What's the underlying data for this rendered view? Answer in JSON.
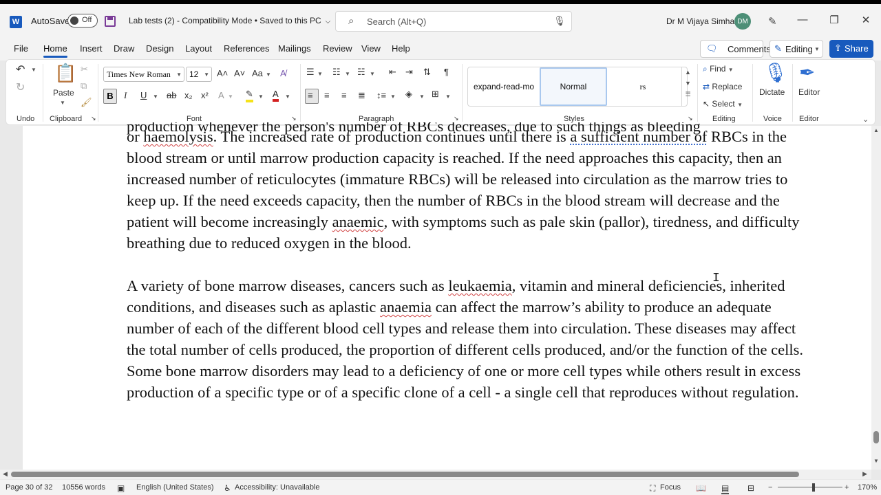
{
  "titlebar": {
    "autosave_label": "AutoSave",
    "autosave_state": "Off",
    "doc_title": "Lab tests (2)  -  Compatibility Mode • Saved to this PC",
    "search_placeholder": "Search (Alt+Q)",
    "user_name": "Dr M Vijaya Simha",
    "user_initials": "DM",
    "app_letter": "W"
  },
  "menu": {
    "items": [
      "File",
      "Home",
      "Insert",
      "Draw",
      "Design",
      "Layout",
      "References",
      "Mailings",
      "Review",
      "View",
      "Help"
    ],
    "active": "Home",
    "comments": "Comments",
    "editing": "Editing",
    "share": "Share"
  },
  "ribbon": {
    "groups": {
      "undo": "Undo",
      "clipboard": "Clipboard",
      "font": "Font",
      "paragraph": "Paragraph",
      "styles": "Styles",
      "editing": "Editing",
      "voice": "Voice",
      "editor": "Editor"
    },
    "paste": "Paste",
    "font_name": "Times New Roman",
    "font_size": "12",
    "styles": [
      "expand-read-mo",
      "Normal",
      "rs"
    ],
    "find": "Find",
    "replace": "Replace",
    "select": "Select",
    "dictate": "Dictate",
    "editor_btn": "Editor"
  },
  "document": {
    "cut_line": "production whenever the person's number of RBCs decreases, due to such things as bleeding",
    "p1": {
      "s1": "or ",
      "w_haemolysis": "haemolysis",
      "s2": ". The increased rate of production continues until there is ",
      "w_sufficient": "a sufficient number of",
      "s3": " RBCs in the blood stream or until marrow production capacity is reached. If the need approaches this capacity, then an increased number of reticulocytes (immature RBCs) will be released into circulation as the marrow tries to keep up. If the need exceeds capacity, then the number of RBCs in the blood stream will decrease and the patient will become increasingly ",
      "w_anaemic": "anaemic",
      "s4": ", with symptoms such as pale skin (pallor), tiredness, and difficulty breathing due to reduced oxygen in the blood."
    },
    "p2": {
      "s1": "A variety of bone marrow diseases, cancers such as ",
      "w_leukaemia": "leukaemia",
      "s2": ", vitamin and mineral deficiencies, inherited conditions, and diseases such as aplastic ",
      "w_anaemia": "anaemia",
      "s3": " can affect the marrow’s ability to produce an adequate number of each of the different blood cell types and release them into circulation. These diseases may affect the total number of cells produced, the proportion of different cells produced, and/or the function of the cells. Some bone marrow disorders may lead to a deficiency of one or more cell types while others result in excess production of a specific type or of a specific clone of a cell - a single cell that reproduces without regulation."
    }
  },
  "status": {
    "page": "Page 30 of 32",
    "words": "10556 words",
    "language": "English (United States)",
    "accessibility": "Accessibility: Unavailable",
    "focus": "Focus",
    "zoom": "170%"
  }
}
